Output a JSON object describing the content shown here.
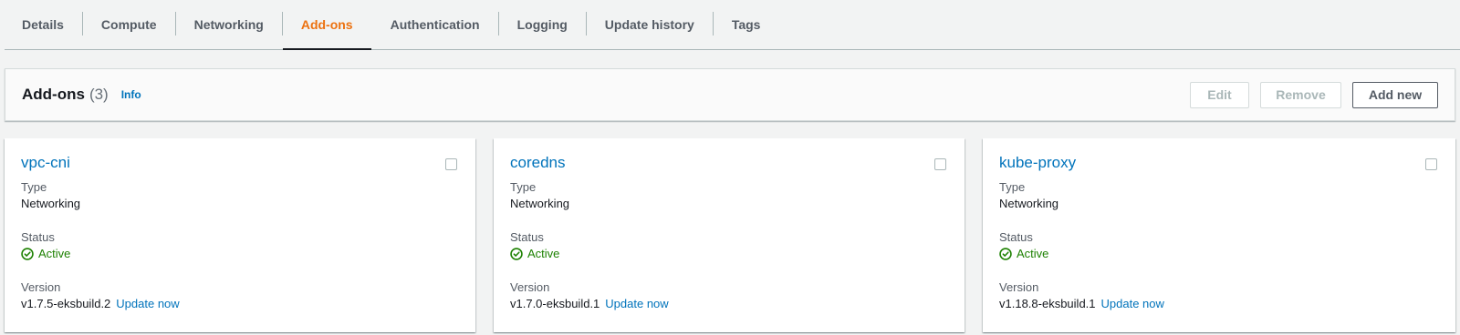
{
  "tabs": [
    {
      "label": "Details"
    },
    {
      "label": "Compute"
    },
    {
      "label": "Networking"
    },
    {
      "label": "Add-ons"
    },
    {
      "label": "Authentication"
    },
    {
      "label": "Logging"
    },
    {
      "label": "Update history"
    },
    {
      "label": "Tags"
    }
  ],
  "active_tab": "Add-ons",
  "header": {
    "title": "Add-ons",
    "count": "(3)",
    "info": "Info",
    "edit_label": "Edit",
    "remove_label": "Remove",
    "add_label": "Add new"
  },
  "field_labels": {
    "type": "Type",
    "status": "Status",
    "version": "Version"
  },
  "addons": [
    {
      "name": "vpc-cni",
      "type": "Networking",
      "status": "Active",
      "version": "v1.7.5-eksbuild.2",
      "update": "Update now"
    },
    {
      "name": "coredns",
      "type": "Networking",
      "status": "Active",
      "version": "v1.7.0-eksbuild.1",
      "update": "Update now"
    },
    {
      "name": "kube-proxy",
      "type": "Networking",
      "status": "Active",
      "version": "v1.18.8-eksbuild.1",
      "update": "Update now"
    }
  ],
  "colors": {
    "accent": "#ec7211",
    "link": "#0073bb",
    "success": "#1d8102"
  },
  "icons": {
    "status": "check-circle-icon"
  }
}
